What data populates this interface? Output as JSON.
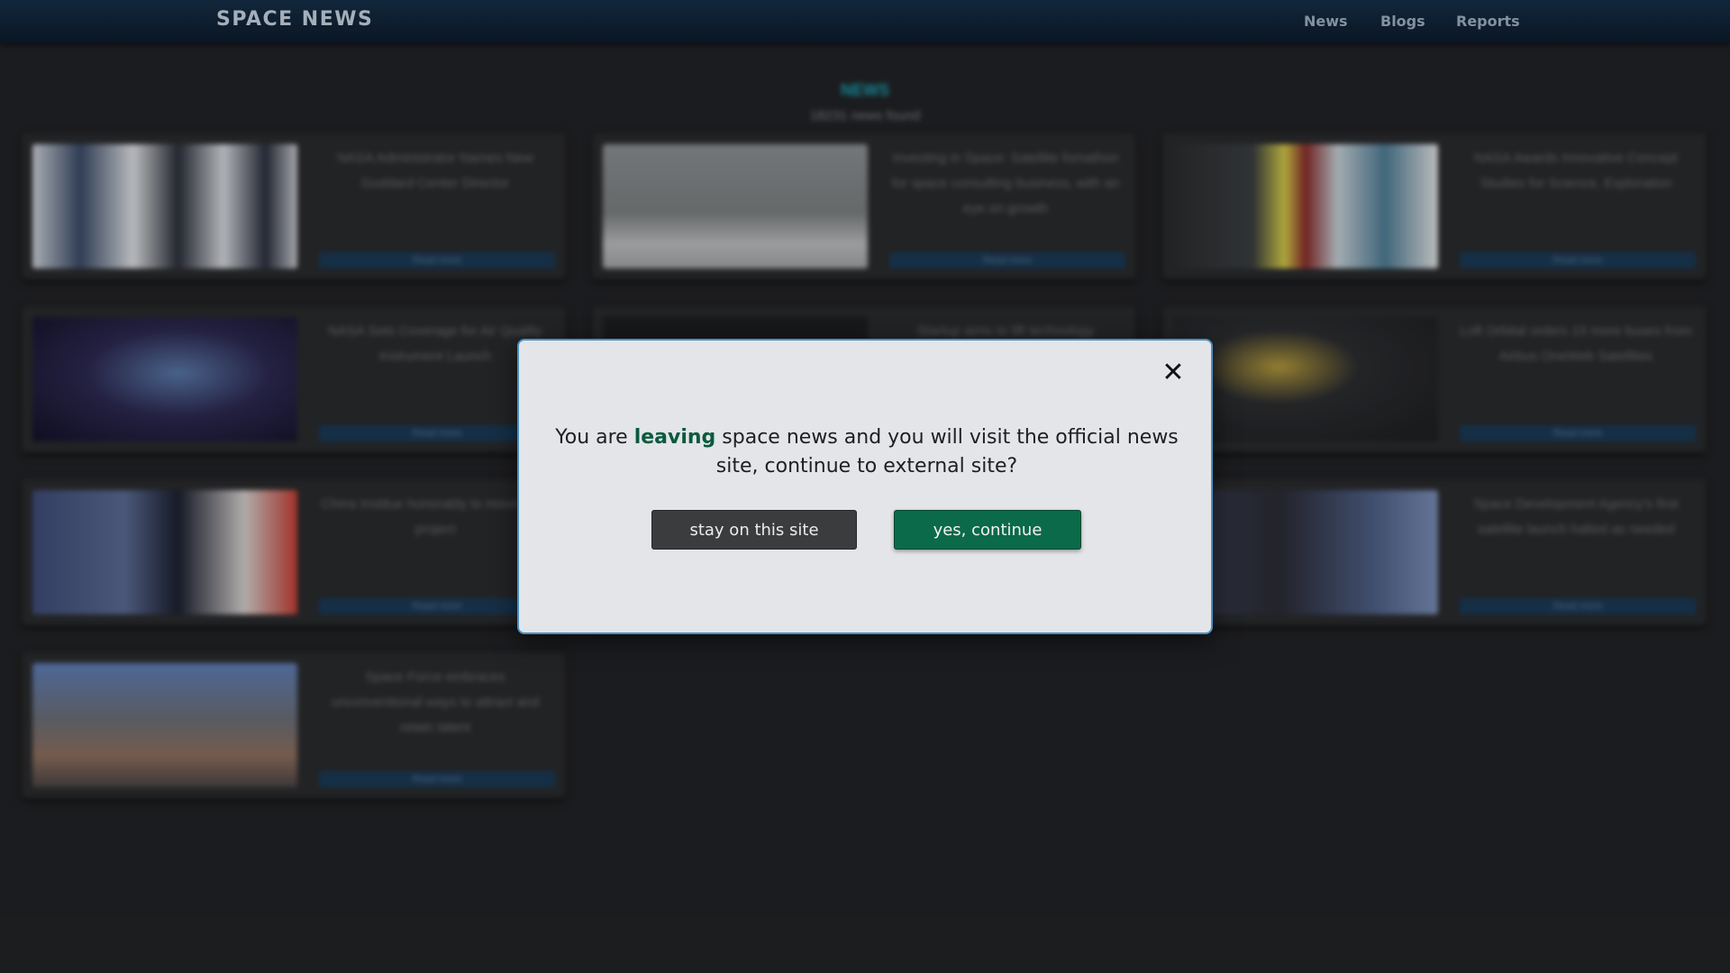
{
  "nav": {
    "brand": "SPACE NEWS",
    "links": [
      "News",
      "Blogs",
      "Reports"
    ]
  },
  "page": {
    "section_title": "NEWS",
    "count_text": "18231 news found",
    "read_more": "Read more",
    "cards": [
      {
        "title": "NASA Administrator Names New Goddard Center Director"
      },
      {
        "title": "Investing in Space: Satellite fomathon for space consulting business, with an eye on growth"
      },
      {
        "title": "NASA Awards Innovative Concept Studies for Science, Exploration"
      },
      {
        "title": "NASA Sets Coverage for Air Quality Instrument Launch"
      },
      {
        "title": "Startup aims to lift technology"
      },
      {
        "title": "Loft Orbital orders 15 more buses from Airbus OneWeb Satellites"
      },
      {
        "title": "China Institue honorably to move from project"
      },
      {
        "title": ""
      },
      {
        "title": "Space Development Agency's first satellite launch halted as needed"
      },
      {
        "title": "Space Force embraces unconventional ways to attract and retain talent"
      }
    ]
  },
  "modal": {
    "close_glyph": "✕",
    "message_prefix": "You are ",
    "message_emphasis": "leaving",
    "message_suffix": " space news and you will visit the official news site, continue to external site?",
    "stay_label": "stay on this site",
    "continue_label": "yes, continue"
  }
}
